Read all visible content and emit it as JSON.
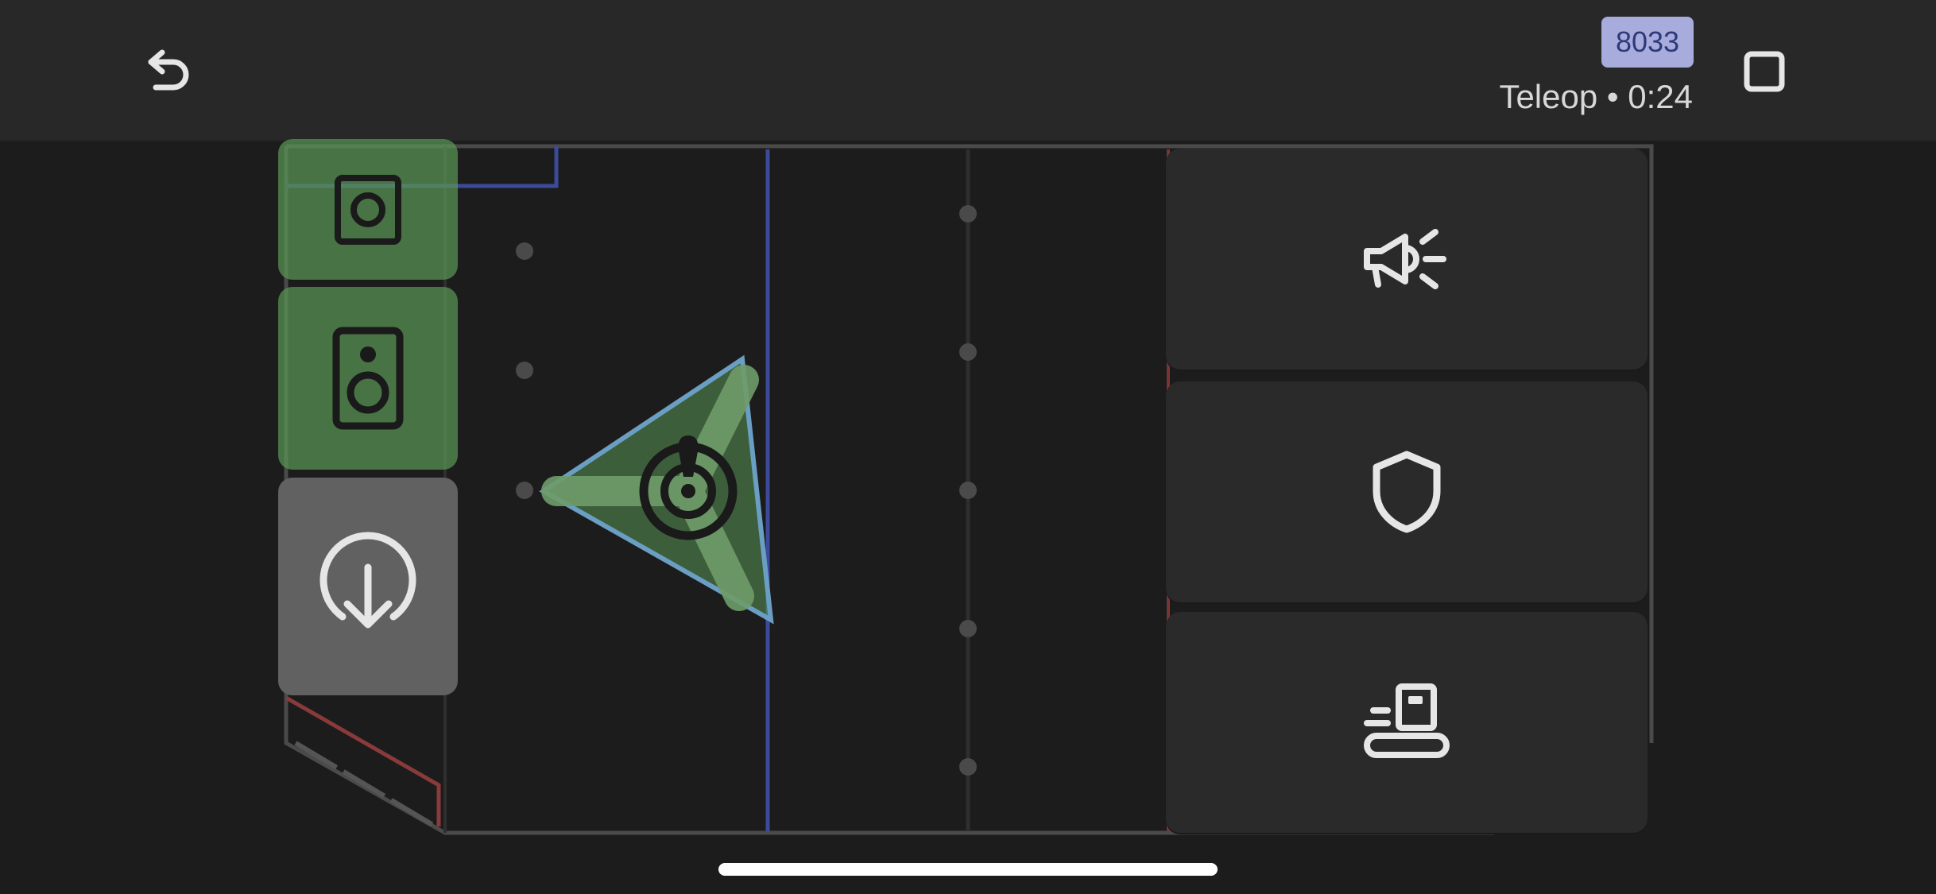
{
  "header": {
    "undo_icon": "undo-icon",
    "team_number": "8033",
    "status": "Teleop • 0:24",
    "stop_icon": "stop-icon"
  },
  "colors": {
    "background": "#1c1c1c",
    "header": "#282828",
    "badge": "#a8acdc",
    "badge_text": "#2d3a7a",
    "blue_line": "#3c4a9a",
    "red_line": "#8a3a3a",
    "robot_green": "#5a9655",
    "button": "#2a2a2a"
  },
  "left_buttons": [
    {
      "name": "speaker-slot",
      "icon": "speaker-small-icon",
      "state": "active"
    },
    {
      "name": "speaker-slot",
      "icon": "speaker-icon",
      "state": "active"
    },
    {
      "name": "intake",
      "icon": "intake-download-icon",
      "state": "neutral"
    }
  ],
  "field": {
    "robot_icon": "robot-target-icon"
  },
  "actions": [
    {
      "name": "amp",
      "icon": "megaphone-icon"
    },
    {
      "name": "defense",
      "icon": "shield-icon"
    },
    {
      "name": "feed",
      "icon": "feeder-icon"
    }
  ]
}
